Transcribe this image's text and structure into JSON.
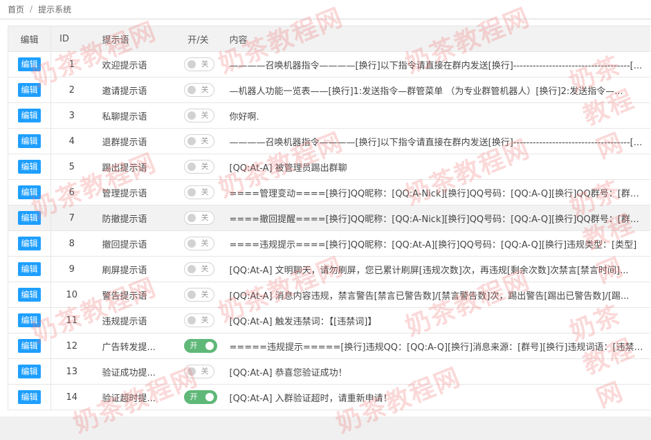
{
  "breadcrumb": {
    "home": "首页",
    "separator": "/",
    "current": "提示系统"
  },
  "table": {
    "headers": {
      "edit": "编辑",
      "id": "ID",
      "title": "提示语",
      "switch": "开/关",
      "content": "内容"
    },
    "rows": [
      {
        "edit": "编辑",
        "id": "1",
        "title": "欢迎提示语",
        "on": false,
        "switch_text": "关",
        "content": "————召唤机器指令————[换行]以下指令请直接在群内发送[换行]------------------------------------[..."
      },
      {
        "edit": "编辑",
        "id": "2",
        "title": "邀请提示语",
        "on": false,
        "switch_text": "关",
        "content": "—机器人功能一览表——[换行]1:发送指令—群管菜单 （为专业群管机器人）[换行]2:发送指令—..."
      },
      {
        "edit": "编辑",
        "id": "3",
        "title": "私聊提示语",
        "on": false,
        "switch_text": "关",
        "content": "你好啊."
      },
      {
        "edit": "编辑",
        "id": "4",
        "title": "退群提示语",
        "on": false,
        "switch_text": "关",
        "content": "————召唤机器指令————[换行]以下指令请直接在群内发送[换行]------------------------------------[..."
      },
      {
        "edit": "编辑",
        "id": "5",
        "title": "踢出提示语",
        "on": false,
        "switch_text": "关",
        "content": "[QQ:At-A] 被管理员踢出群聊"
      },
      {
        "edit": "编辑",
        "id": "6",
        "title": "管理提示语",
        "on": false,
        "switch_text": "关",
        "content": "====管理变动====[换行]QQ昵称：[QQ:A-Nick][换行]QQ号码：[QQ:A-Q][换行]QQ群号：[群号][..."
      },
      {
        "edit": "编辑",
        "id": "7",
        "title": "防撤提示语",
        "on": false,
        "switch_text": "关",
        "content": "====撤回提醒====[换行]QQ昵称：[QQ:A-Nick][换行]QQ号码：[QQ:A-Q][换行]QQ群号：[群号][..."
      },
      {
        "edit": "编辑",
        "id": "8",
        "title": "撤回提示语",
        "on": false,
        "switch_text": "关",
        "content": "====违规提示====[换行]QQ昵称：[QQ:At-A][换行]QQ号码：[QQ:A-Q][换行]违规类型：[类型]"
      },
      {
        "edit": "编辑",
        "id": "9",
        "title": "刷屏提示语",
        "on": false,
        "switch_text": "关",
        "content": "[QQ:At-A] 文明聊天，请勿刷屏，您已累计刷屏[违规次数]次，再违规[剩余次数]次禁言[禁言时间]..."
      },
      {
        "edit": "编辑",
        "id": "10",
        "title": "警告提示语",
        "on": false,
        "switch_text": "关",
        "content": "[QQ:At-A] 消息内容违规，禁言警告[禁言已警告数]/[禁言警告数]次，踢出警告[踢出已警告数]/[踢..."
      },
      {
        "edit": "编辑",
        "id": "11",
        "title": "违规提示语",
        "on": false,
        "switch_text": "关",
        "content": "[QQ:At-A] 触发违禁词：【[违禁词]】"
      },
      {
        "edit": "编辑",
        "id": "12",
        "title": "广告转发提...",
        "on": true,
        "switch_text": "开",
        "content": "=====违规提示=====[换行]违规QQ：[QQ:A-Q][换行]消息来源：[群号][换行]违规词语：[违禁词][..."
      },
      {
        "edit": "编辑",
        "id": "13",
        "title": "验证成功提...",
        "on": false,
        "switch_text": "关",
        "content": "[QQ:At-A] 恭喜您验证成功！"
      },
      {
        "edit": "编辑",
        "id": "14",
        "title": "验证超时提...",
        "on": true,
        "switch_text": "开",
        "content": "[QQ:At-A] 入群验证超时，请重新申请！"
      }
    ]
  },
  "watermark": "奶茶教程网",
  "colors": {
    "accent": "#1e9fff",
    "switch_on": "#5fb878",
    "switch_off": "#d2d2d2",
    "hover_row": "#f2f2f2"
  }
}
